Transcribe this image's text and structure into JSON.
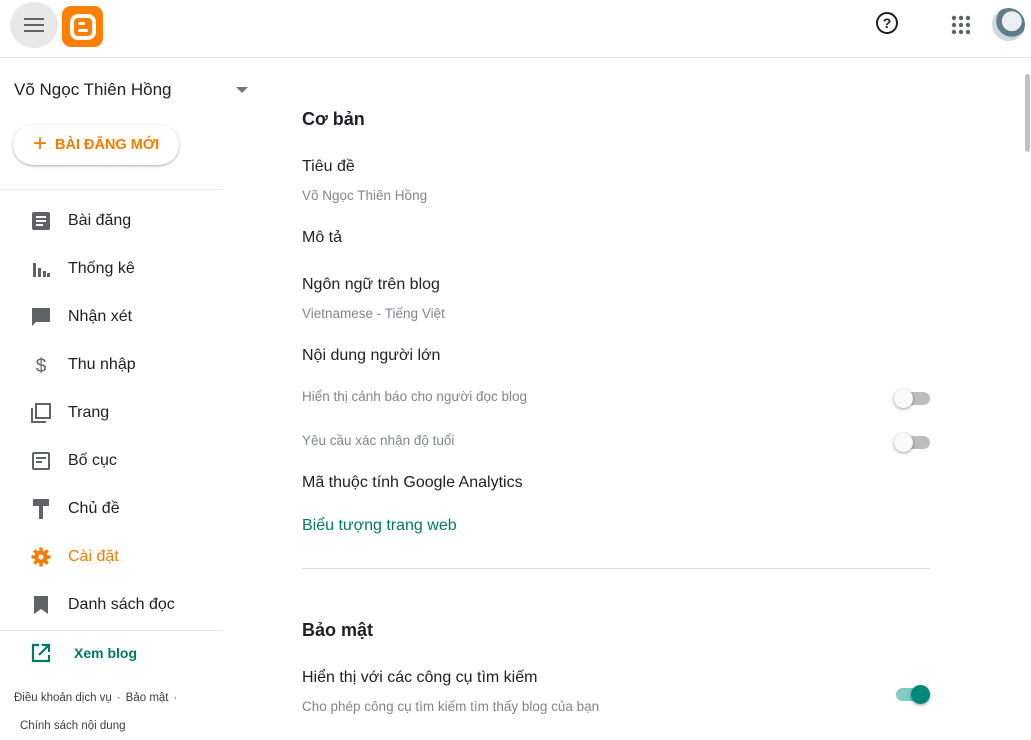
{
  "header": {
    "menu_icon": "hamburger-menu-icon",
    "logo_icon": "blogger-logo-icon",
    "help_icon": "help-circle-icon",
    "apps_icon": "apps-grid-icon",
    "brand_color": "#ff8000"
  },
  "sidebar": {
    "blog_name": "Võ Ngọc Thiên Hồng",
    "new_post_label": "BÀI ĐĂNG MỚI",
    "items": [
      {
        "label": "Bài đăng",
        "icon": "posts-icon"
      },
      {
        "label": "Thống kê",
        "icon": "stats-icon"
      },
      {
        "label": "Nhận xét",
        "icon": "comment-icon"
      },
      {
        "label": "Thu nhập",
        "icon": "dollar-icon"
      },
      {
        "label": "Trang",
        "icon": "pages-icon"
      },
      {
        "label": "Bố cục",
        "icon": "layout-icon"
      },
      {
        "label": "Chủ đề",
        "icon": "theme-brush-icon"
      },
      {
        "label": "Cài đặt",
        "icon": "settings-gear-icon",
        "active": true
      },
      {
        "label": "Danh sách đọc",
        "icon": "bookmark-icon"
      }
    ],
    "view_blog_label": "Xem blog",
    "footer": {
      "terms": "Điều khoản dịch vụ",
      "privacy": "Bảo mật",
      "content_policy": "Chính sách nội dung"
    },
    "accent_color": "#f57c00",
    "link_color": "#00796b"
  },
  "main": {
    "basic": {
      "title": "Cơ bản",
      "title_label": "Tiêu đề",
      "title_value": "Võ Ngọc Thiên Hồng",
      "description_label": "Mô tả",
      "language_label": "Ngôn ngữ trên blog",
      "language_value": "Vietnamese - Tiếng Việt",
      "adult_label": "Nội dung người lớn",
      "adult_warning_label": "Hiển thị cảnh báo cho người đọc blog",
      "adult_warning_on": false,
      "age_verify_label": "Yêu cầu xác nhận độ tuổi",
      "age_verify_on": false,
      "analytics_label": "Mã thuộc tính Google Analytics",
      "favicon_label": "Biểu tượng trang web"
    },
    "security": {
      "title": "Bảo mật",
      "search_visible_label": "Hiển thị với các công cụ tìm kiếm",
      "search_visible_desc": "Cho phép công cụ tìm kiếm tìm thấy blog của bạn",
      "search_visible_on": true
    }
  }
}
